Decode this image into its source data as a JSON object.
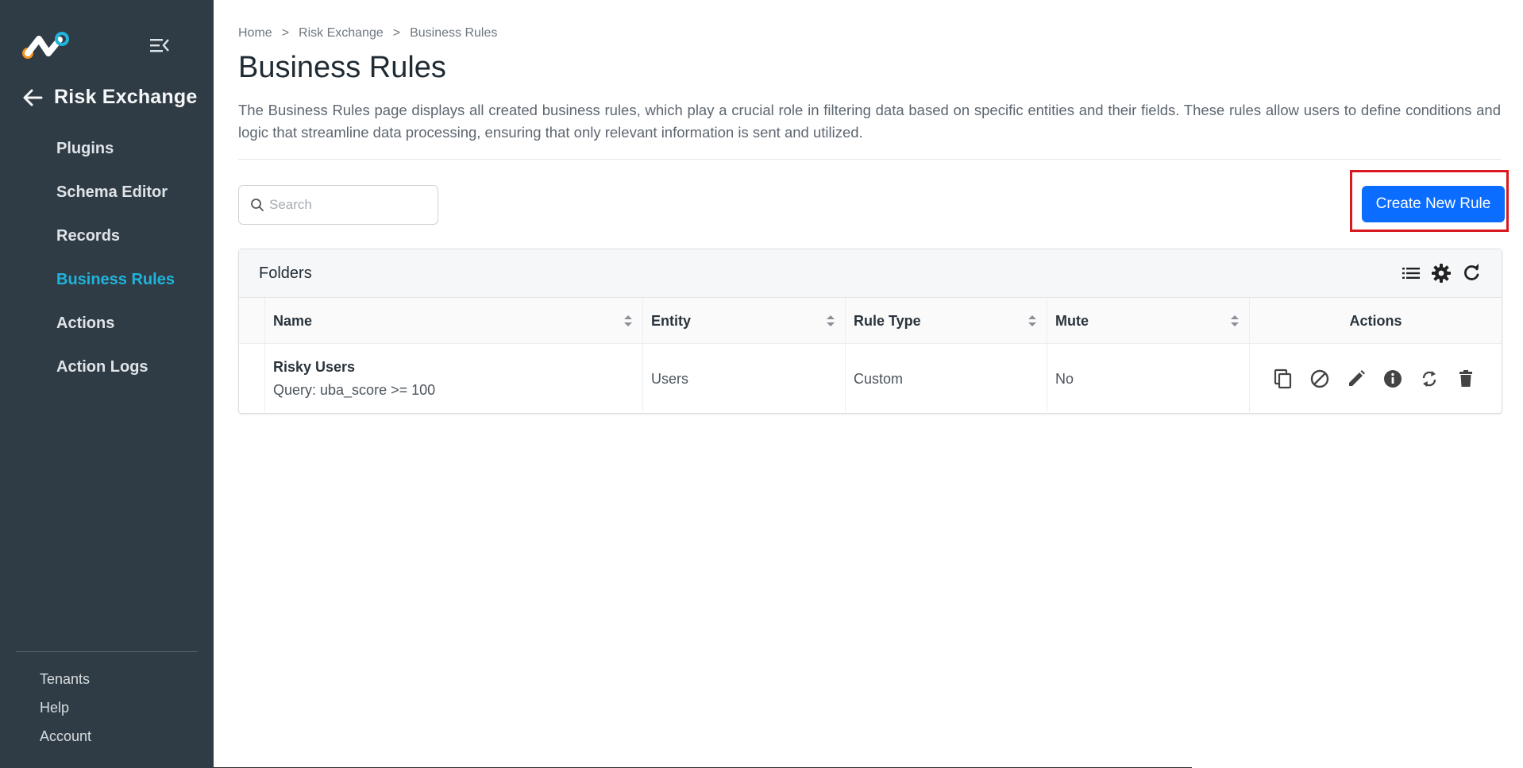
{
  "sidebar": {
    "app_title": "Risk Exchange",
    "items": [
      {
        "label": "Plugins",
        "active": false
      },
      {
        "label": "Schema Editor",
        "active": false
      },
      {
        "label": "Records",
        "active": false
      },
      {
        "label": "Business Rules",
        "active": true
      },
      {
        "label": "Actions",
        "active": false
      },
      {
        "label": "Action Logs",
        "active": false
      }
    ],
    "footer": [
      "Tenants",
      "Help",
      "Account"
    ],
    "colors": {
      "background": "#303c45",
      "active": "#1fb4dc"
    }
  },
  "breadcrumb": [
    "Home",
    "Risk Exchange",
    "Business Rules"
  ],
  "page": {
    "title": "Business Rules",
    "description": "The Business Rules page displays all created business rules, which play a crucial role in filtering data based on specific entities and their fields. These rules allow users to define conditions and logic that streamline data processing, ensuring that only relevant information is sent and utilized."
  },
  "search": {
    "placeholder": "Search",
    "value": ""
  },
  "create_button": {
    "label": "Create New Rule",
    "color": "#0a6dff",
    "highlight": "#d9181f"
  },
  "folders": {
    "title": "Folders",
    "tools": [
      "list-icon",
      "gear-icon",
      "refresh-icon"
    ],
    "columns": [
      "Name",
      "Entity",
      "Rule Type",
      "Mute",
      "Actions"
    ],
    "rows": [
      {
        "name": "Risky Users",
        "query": "Query: uba_score >= 100",
        "entity": "Users",
        "rule_type": "Custom",
        "mute": "No",
        "actions": [
          "copy-icon",
          "block-icon",
          "edit-icon",
          "info-icon",
          "sync-icon",
          "delete-icon"
        ]
      }
    ]
  }
}
